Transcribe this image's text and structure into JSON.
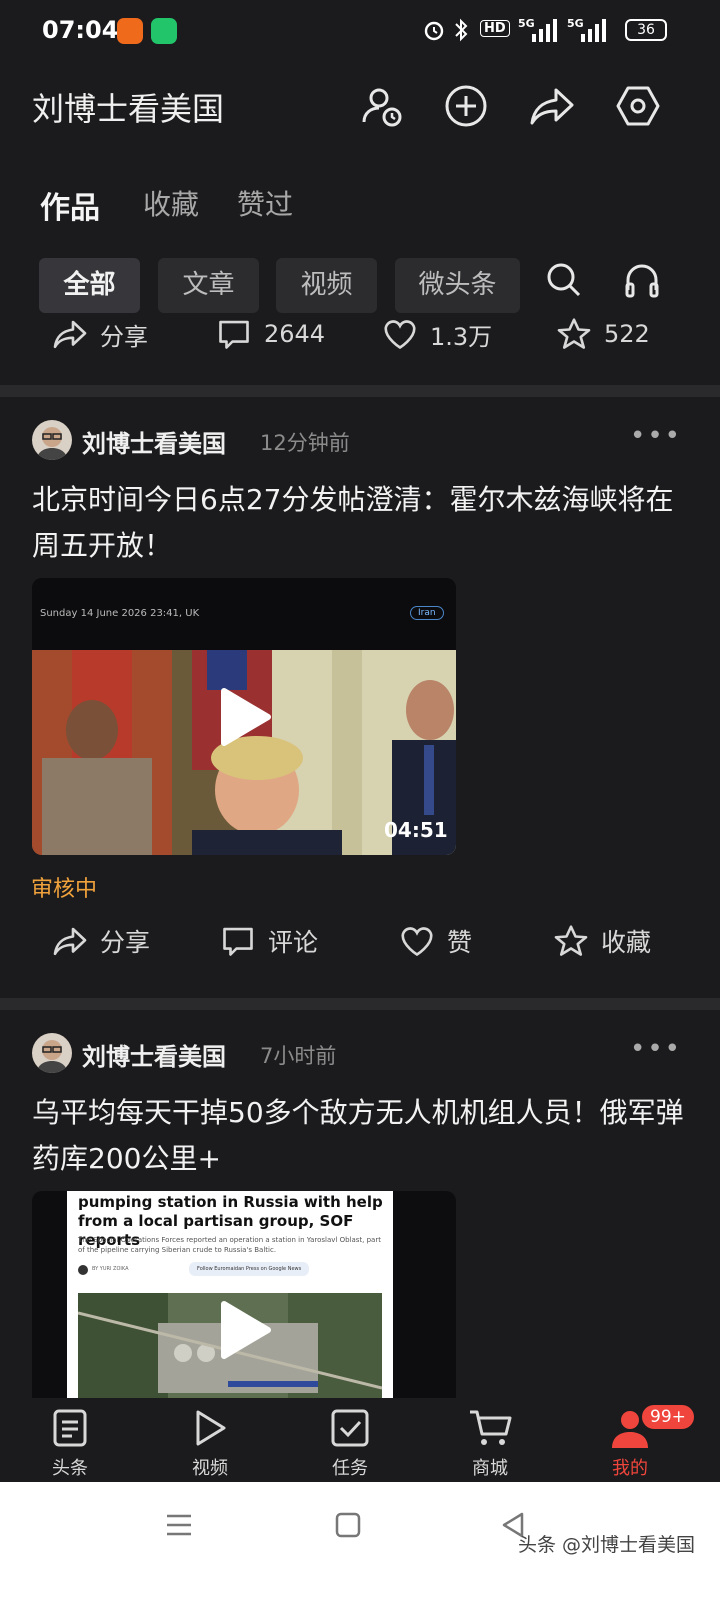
{
  "status_bar": {
    "time": "07:04",
    "battery": "36"
  },
  "header": {
    "title": "刘博士看美国"
  },
  "profile_tabs": [
    {
      "label": "作品"
    },
    {
      "label": "收藏"
    },
    {
      "label": "赞过"
    }
  ],
  "filter_chips": [
    {
      "label": "全部"
    },
    {
      "label": "文章"
    },
    {
      "label": "视频"
    },
    {
      "label": "微头条"
    }
  ],
  "stats": {
    "share_label": "分享",
    "comments": "2644",
    "likes": "1.3万",
    "favorites": "522"
  },
  "posts": [
    {
      "author": "刘博士看美国",
      "time": "12分钟前",
      "title": "北京时间今日6点27分发帖澄清：霍尔木兹海峡将在周五开放！",
      "video": {
        "caption_date": "Sunday 14 June 2026 23:41, UK",
        "tag": "Iran",
        "duration": "04:51"
      },
      "status": "审核中",
      "actions": {
        "share": "分享",
        "comment": "评论",
        "like": "赞",
        "favorite": "收藏"
      }
    },
    {
      "author": "刘博士看美国",
      "time": "7小时前",
      "title": "乌平均每天干掉50多个敌方无人机机组人员！俄军弹药库200公里+",
      "video": {
        "headline": "pumping station in Russia with help from a local partisan group, SOF reports",
        "body": "The Special Operations Forces reported an operation a station in Yaroslavl Oblast, part of the pipeline carrying Siberian crude to Russia's Baltic.",
        "byline": "BY YURI ZOIKA",
        "follow": "Follow Euromaidan Press on Google News"
      }
    }
  ],
  "bottom_nav": [
    {
      "label": "头条"
    },
    {
      "label": "视频"
    },
    {
      "label": "任务"
    },
    {
      "label": "商城"
    },
    {
      "label": "我的",
      "badge": "99+"
    }
  ],
  "watermark": "头条 @刘博士看美国",
  "colors": {
    "accent": "#f0453c",
    "review": "#f0a23c",
    "background": "#1b1b1d"
  }
}
